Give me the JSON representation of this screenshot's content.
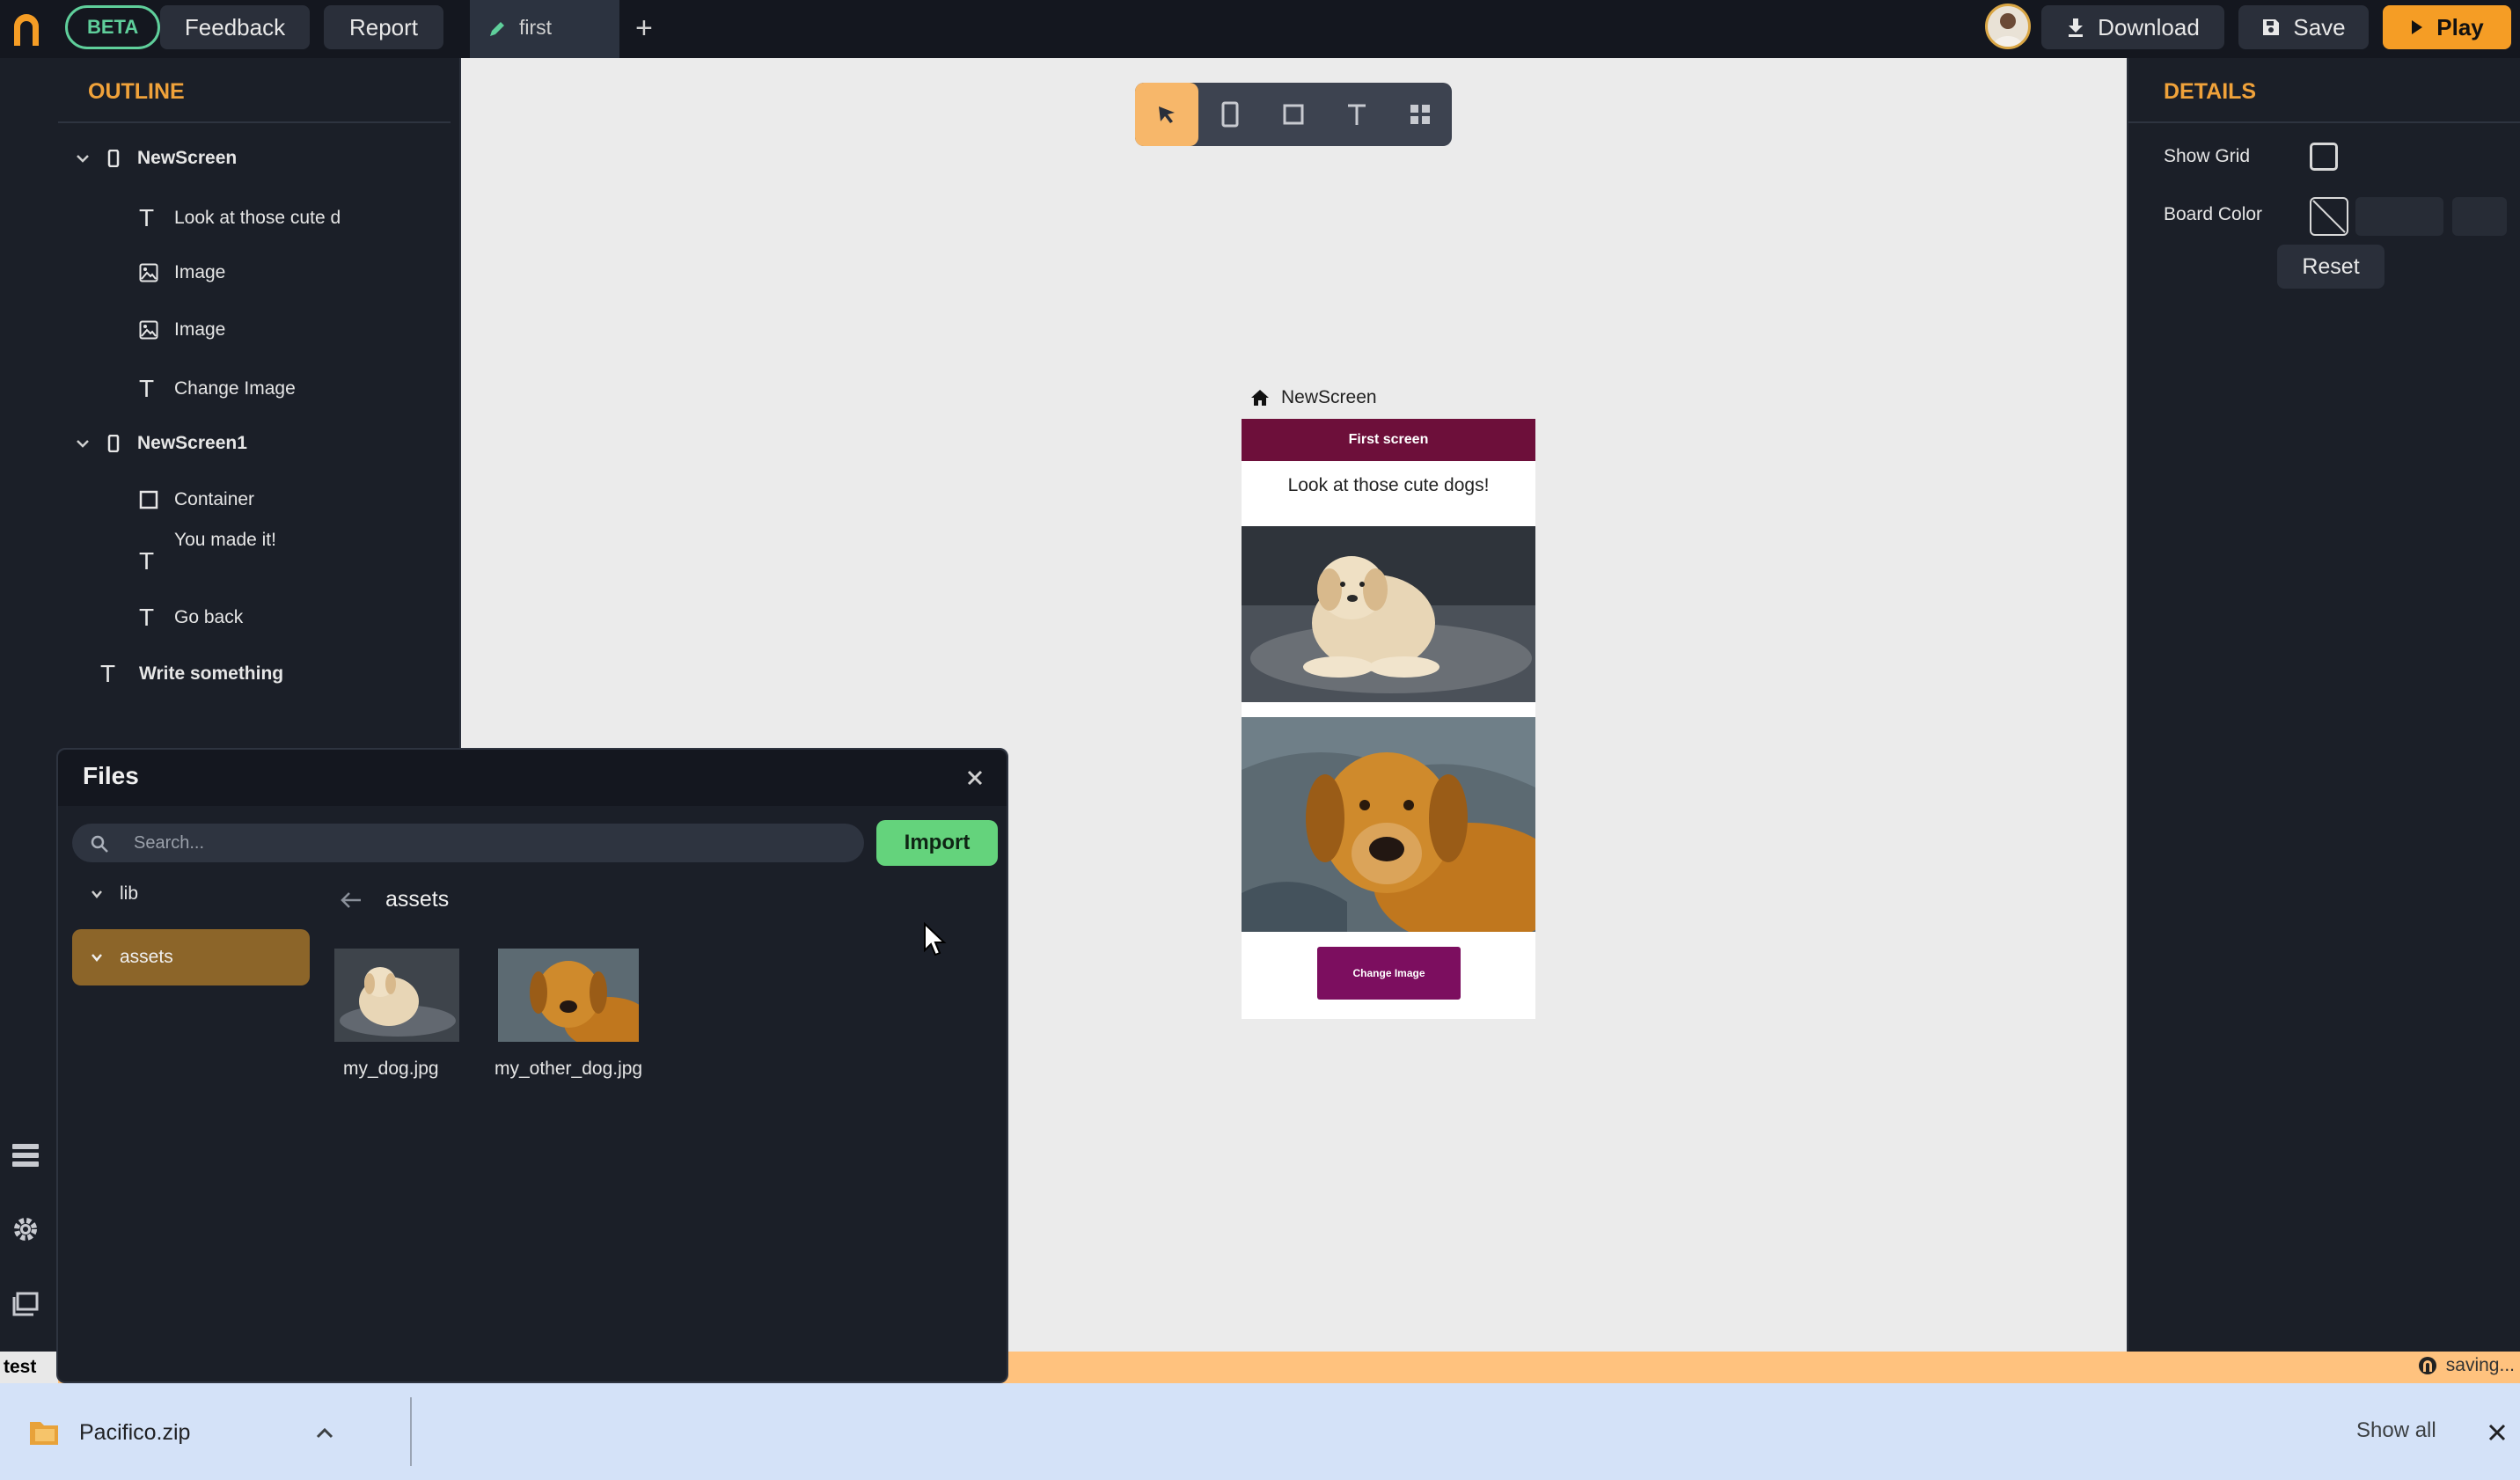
{
  "topbar": {
    "beta": "BETA",
    "feedback": "Feedback",
    "report": "Report",
    "tab_label": "first",
    "download": "Download",
    "save": "Save",
    "play": "Play",
    "accent_color": "#f59d25"
  },
  "outline": {
    "title": "OUTLINE",
    "items": [
      {
        "label": "NewScreen",
        "icon": "phone-icon",
        "bold": true,
        "expanded": true
      },
      {
        "label": "Look at those cute d",
        "icon": "text-icon"
      },
      {
        "label": "Image",
        "icon": "image-icon"
      },
      {
        "label": "Image",
        "icon": "image-icon"
      },
      {
        "label": "Change Image",
        "icon": "text-icon"
      },
      {
        "label": "NewScreen1",
        "icon": "phone-icon",
        "bold": true,
        "expanded": true
      },
      {
        "label": "Container",
        "icon": "square-icon"
      },
      {
        "label": "You made it!",
        "icon": "text-icon"
      },
      {
        "label": "Go back",
        "icon": "text-icon"
      },
      {
        "label": "Write something",
        "icon": "text-icon",
        "bold": true
      }
    ]
  },
  "canvas": {
    "screen_name": "NewScreen",
    "appbar_title": "First screen",
    "text": "Look at those cute dogs!",
    "button_label": "Change Image",
    "appbar_color": "#6d0f3a",
    "button_color": "#7c0e5f"
  },
  "details": {
    "title": "DETAILS",
    "show_grid": "Show Grid",
    "board_color": "Board Color",
    "reset": "Reset"
  },
  "files": {
    "title": "Files",
    "search_placeholder": "Search...",
    "import": "Import",
    "tree": [
      "lib",
      "assets"
    ],
    "current_folder": "assets",
    "items": [
      "my_dog.jpg",
      "my_other_dog.jpg"
    ]
  },
  "status": {
    "left": "test",
    "right": "saving..."
  },
  "download_bar": {
    "file": "Pacifico.zip",
    "show_all": "Show all"
  }
}
